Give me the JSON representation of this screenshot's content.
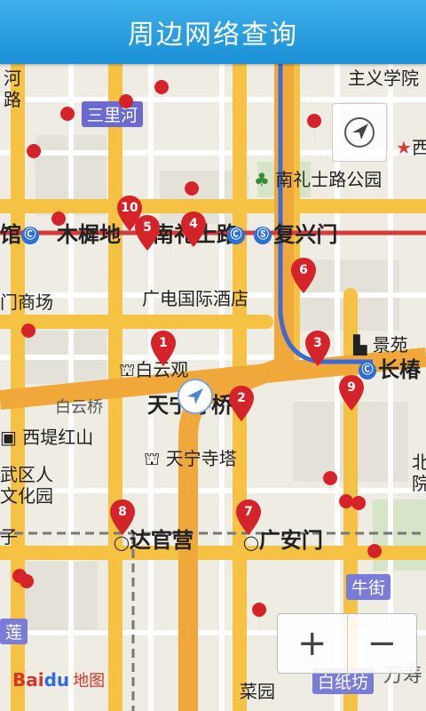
{
  "header": {
    "title": "周边网络查询"
  },
  "map": {
    "labels": {
      "hebei": "河",
      "lu": "路",
      "sanlihe": "三里河",
      "guan": "馆",
      "muxidi": "木樨地",
      "nanlishilu": "南礼士路",
      "fuxingmen": "复兴门",
      "nanlishilu_park": "南礼士路公园",
      "zhuyixueyuan": "主义学院",
      "xi": "西",
      "menshangchang": "门商场",
      "guangdian_hotel": "广电国际酒店",
      "baiyunguan": "白云观",
      "jingyuan": "景苑",
      "changchun": "长椿",
      "baiyunqiao": "白云桥",
      "tianningsi_qiao": "天宁寺桥",
      "xidihongshan": "西堤红山",
      "wuqu_renmin": "武区人",
      "wenhuayuan": "文化园",
      "tianningsi_ta": "天宁寺塔",
      "bei": "北",
      "yuan": "院",
      "zi": "子",
      "daguanying": "达官营",
      "guanganmen": "广安门",
      "niujie": "牛街",
      "lian": "莲",
      "baizhifang": "白纸坊",
      "wanshou": "万寿",
      "caiyuan": "菜园"
    },
    "pins": [
      "1",
      "2",
      "3",
      "4",
      "5",
      "6",
      "7",
      "8",
      "9",
      "10"
    ],
    "colors": {
      "pin": "#d4242a",
      "road_major": "#f6c54a",
      "road_minor": "#ffffff",
      "header": "#2a9be0"
    },
    "logo": {
      "bai": "Bai",
      "du": "du",
      "tu": "地图"
    },
    "controls": {
      "zoom_in": "+",
      "zoom_out": "−"
    }
  }
}
